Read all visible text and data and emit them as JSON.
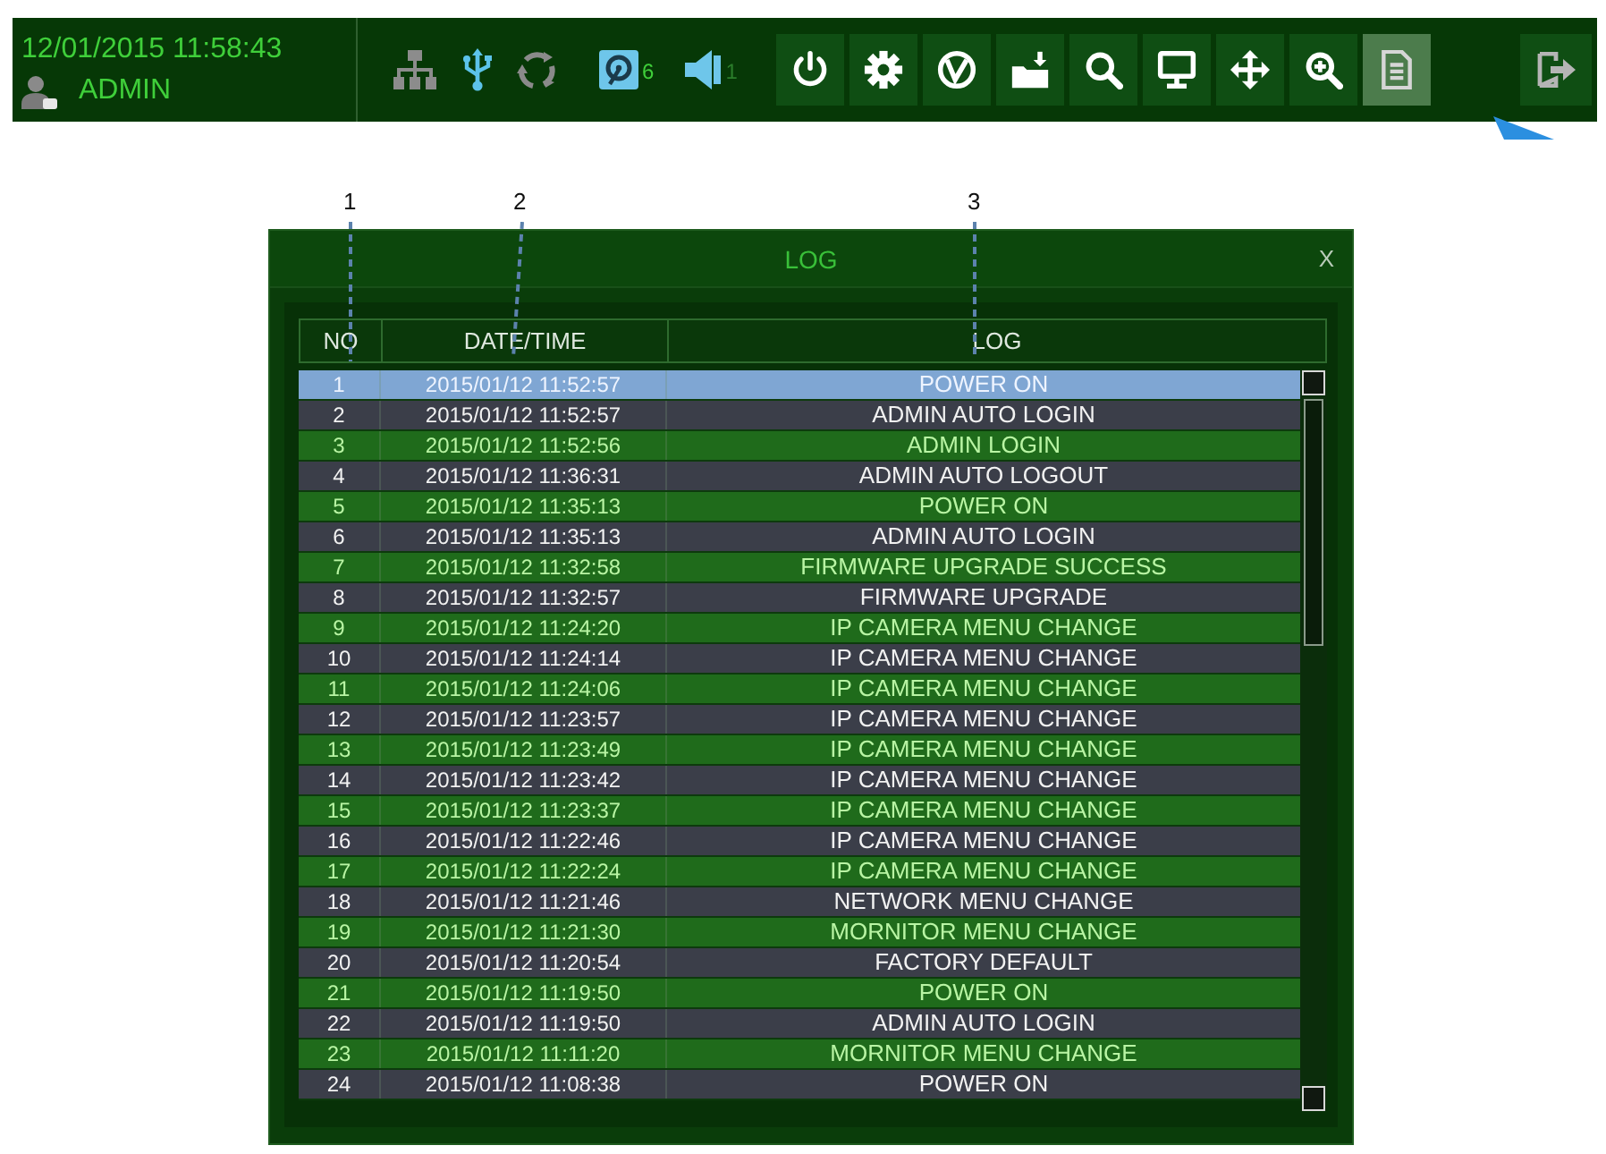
{
  "status": {
    "datetime": "12/01/2015 11:58:43",
    "user": "ADMIN",
    "hdd_count": "6",
    "audio_count": "1"
  },
  "toolbar": {
    "buttons": [
      {
        "kind": "power",
        "selected": false
      },
      {
        "kind": "settings",
        "selected": false
      },
      {
        "kind": "va",
        "selected": false
      },
      {
        "kind": "backup",
        "selected": false
      },
      {
        "kind": "search",
        "selected": false
      },
      {
        "kind": "display",
        "selected": false
      },
      {
        "kind": "move",
        "selected": false
      },
      {
        "kind": "zoom",
        "selected": false
      },
      {
        "kind": "log",
        "selected": true
      }
    ]
  },
  "callouts": [
    "1",
    "2",
    "3"
  ],
  "dialog": {
    "title": "LOG",
    "close_label": "X",
    "columns": [
      "NO",
      "DATE/TIME",
      "LOG"
    ],
    "rows": [
      {
        "no": "1",
        "datetime": "2015/01/12 11:52:57",
        "event": "POWER ON",
        "selected": true
      },
      {
        "no": "2",
        "datetime": "2015/01/12 11:52:57",
        "event": "ADMIN AUTO LOGIN",
        "selected": false
      },
      {
        "no": "3",
        "datetime": "2015/01/12 11:52:56",
        "event": "ADMIN LOGIN",
        "selected": false
      },
      {
        "no": "4",
        "datetime": "2015/01/12 11:36:31",
        "event": "ADMIN AUTO LOGOUT",
        "selected": false
      },
      {
        "no": "5",
        "datetime": "2015/01/12 11:35:13",
        "event": "POWER ON",
        "selected": false
      },
      {
        "no": "6",
        "datetime": "2015/01/12 11:35:13",
        "event": "ADMIN AUTO LOGIN",
        "selected": false
      },
      {
        "no": "7",
        "datetime": "2015/01/12 11:32:58",
        "event": "FIRMWARE UPGRADE SUCCESS",
        "selected": false
      },
      {
        "no": "8",
        "datetime": "2015/01/12 11:32:57",
        "event": "FIRMWARE UPGRADE",
        "selected": false
      },
      {
        "no": "9",
        "datetime": "2015/01/12 11:24:20",
        "event": "IP CAMERA MENU CHANGE",
        "selected": false
      },
      {
        "no": "10",
        "datetime": "2015/01/12 11:24:14",
        "event": "IP CAMERA MENU CHANGE",
        "selected": false
      },
      {
        "no": "11",
        "datetime": "2015/01/12 11:24:06",
        "event": "IP CAMERA MENU CHANGE",
        "selected": false
      },
      {
        "no": "12",
        "datetime": "2015/01/12 11:23:57",
        "event": "IP CAMERA MENU CHANGE",
        "selected": false
      },
      {
        "no": "13",
        "datetime": "2015/01/12 11:23:49",
        "event": "IP CAMERA MENU CHANGE",
        "selected": false
      },
      {
        "no": "14",
        "datetime": "2015/01/12 11:23:42",
        "event": "IP CAMERA MENU CHANGE",
        "selected": false
      },
      {
        "no": "15",
        "datetime": "2015/01/12 11:23:37",
        "event": "IP CAMERA MENU CHANGE",
        "selected": false
      },
      {
        "no": "16",
        "datetime": "2015/01/12 11:22:46",
        "event": "IP CAMERA MENU CHANGE",
        "selected": false
      },
      {
        "no": "17",
        "datetime": "2015/01/12 11:22:24",
        "event": "IP CAMERA MENU CHANGE",
        "selected": false
      },
      {
        "no": "18",
        "datetime": "2015/01/12 11:21:46",
        "event": "NETWORK MENU CHANGE",
        "selected": false
      },
      {
        "no": "19",
        "datetime": "2015/01/12 11:21:30",
        "event": "MORNITOR MENU CHANGE",
        "selected": false
      },
      {
        "no": "20",
        "datetime": "2015/01/12 11:20:54",
        "event": "FACTORY DEFAULT",
        "selected": false
      },
      {
        "no": "21",
        "datetime": "2015/01/12 11:19:50",
        "event": "POWER ON",
        "selected": false
      },
      {
        "no": "22",
        "datetime": "2015/01/12 11:19:50",
        "event": "ADMIN AUTO LOGIN",
        "selected": false
      },
      {
        "no": "23",
        "datetime": "2015/01/12 11:11:20",
        "event": "MORNITOR MENU CHANGE",
        "selected": false
      },
      {
        "no": "24",
        "datetime": "2015/01/12 11:08:38",
        "event": "POWER ON",
        "selected": false
      }
    ]
  }
}
